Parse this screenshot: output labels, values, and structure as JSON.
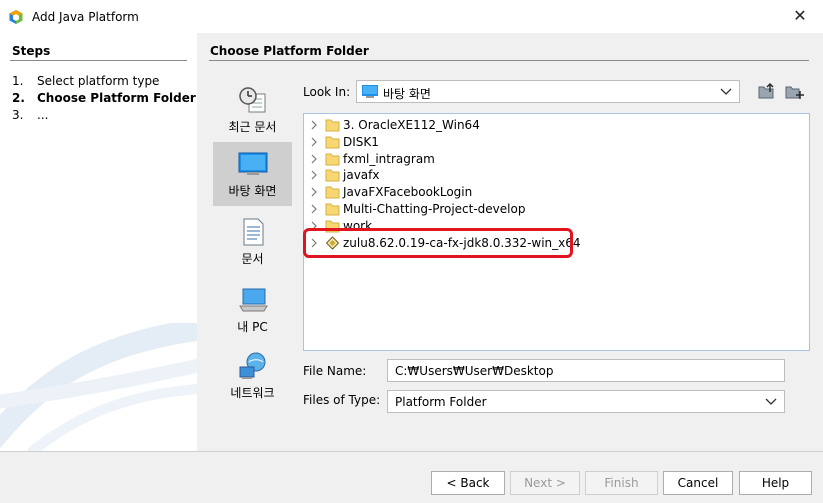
{
  "window": {
    "title": "Add Java Platform"
  },
  "steps": {
    "title": "Steps",
    "items": [
      {
        "num": "1.",
        "label": "Select platform type",
        "current": false
      },
      {
        "num": "2.",
        "label": "Choose Platform Folder",
        "current": true
      },
      {
        "num": "3.",
        "label": "...",
        "current": false
      }
    ]
  },
  "main": {
    "title": "Choose Platform Folder"
  },
  "places": [
    {
      "label": "최근 문서",
      "icon": "recent-documents-icon"
    },
    {
      "label": "바탕 화면",
      "icon": "desktop-icon",
      "selected": true
    },
    {
      "label": "문서",
      "icon": "documents-icon"
    },
    {
      "label": "내 PC",
      "icon": "computer-icon"
    },
    {
      "label": "네트워크",
      "icon": "network-icon"
    }
  ],
  "look_in": {
    "label": "Look In:",
    "value": "바탕 화면"
  },
  "files": [
    {
      "name": "3. OracleXE112_Win64",
      "type": "folder"
    },
    {
      "name": "DISK1",
      "type": "folder"
    },
    {
      "name": "fxml_intragram",
      "type": "folder"
    },
    {
      "name": "javafx",
      "type": "folder"
    },
    {
      "name": "JavaFXFacebookLogin",
      "type": "folder"
    },
    {
      "name": "Multi-Chatting-Project-develop",
      "type": "folder"
    },
    {
      "name": "work",
      "type": "folder"
    },
    {
      "name": "zulu8.62.0.19-ca-fx-jdk8.0.332-win_x64",
      "type": "platform"
    }
  ],
  "file_name": {
    "label": "File Name:",
    "value": "C:₩Users₩User₩Desktop"
  },
  "files_of_type": {
    "label": "Files of Type:",
    "value": "Platform Folder"
  },
  "buttons": {
    "back": "< Back",
    "next": "Next >",
    "finish": "Finish",
    "cancel": "Cancel",
    "help": "Help"
  },
  "colors": {
    "highlight": "#e0151f",
    "selection": "#cfcfcf",
    "folder": "#f7d774"
  }
}
